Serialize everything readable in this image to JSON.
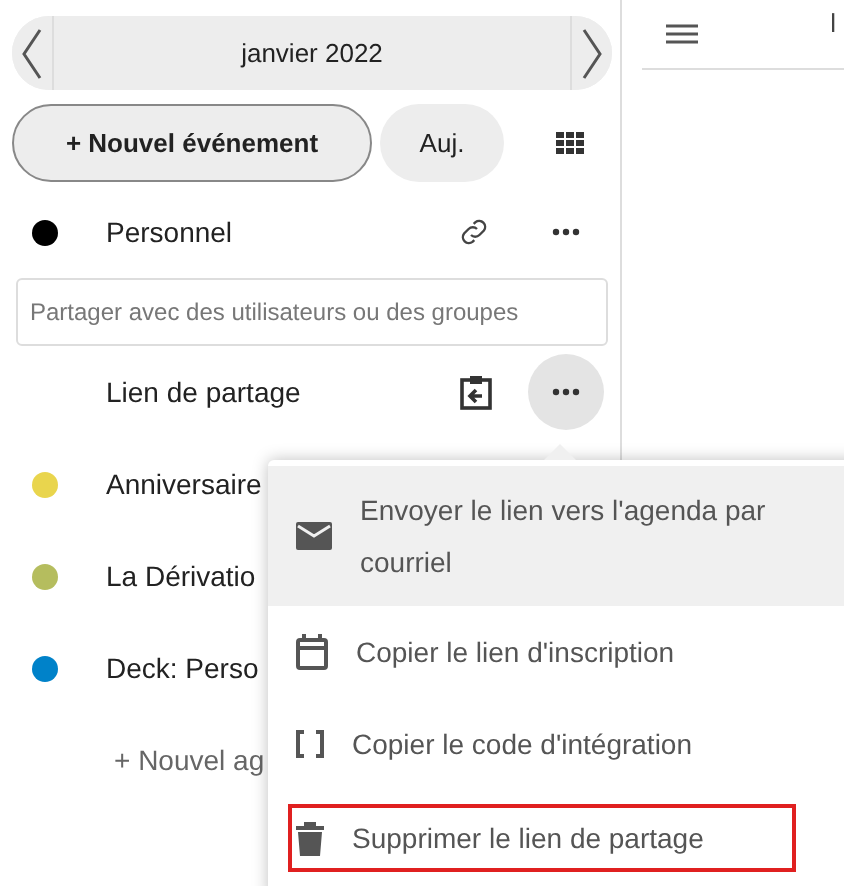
{
  "navigator": {
    "month": "janvier 2022"
  },
  "toolbar": {
    "new_event": "+ Nouvel événement",
    "today": "Auj."
  },
  "calendars": [
    {
      "kind": "calendar",
      "name": "Personnel",
      "color": "#000000"
    },
    {
      "kind": "share-field",
      "placeholder": "Partager avec des utilisateurs ou des groupes"
    },
    {
      "kind": "share-link",
      "name": "Lien de partage",
      "menu_open": true
    },
    {
      "kind": "calendar",
      "name": "Anniversaire",
      "color": "#e9d54d"
    },
    {
      "kind": "calendar",
      "name": "La Dérivatio",
      "color": "#b5bd5e"
    },
    {
      "kind": "calendar",
      "name": "Deck: Perso",
      "color": "#0082c9"
    },
    {
      "kind": "add",
      "name": "+ Nouvel ag"
    }
  ],
  "main": {
    "column_1": "l"
  },
  "menu": [
    {
      "kind": "mail",
      "label": "Envoyer le lien vers l'agenda par courriel",
      "highlighted": true,
      "outlined": false
    },
    {
      "kind": "calendar",
      "label": "Copier le lien d'inscription",
      "highlighted": false,
      "outlined": false
    },
    {
      "kind": "code",
      "label": "Copier le code d'intégration",
      "highlighted": false,
      "outlined": false
    },
    {
      "kind": "delete",
      "label": "Supprimer le lien de partage",
      "highlighted": false,
      "outlined": true
    }
  ]
}
